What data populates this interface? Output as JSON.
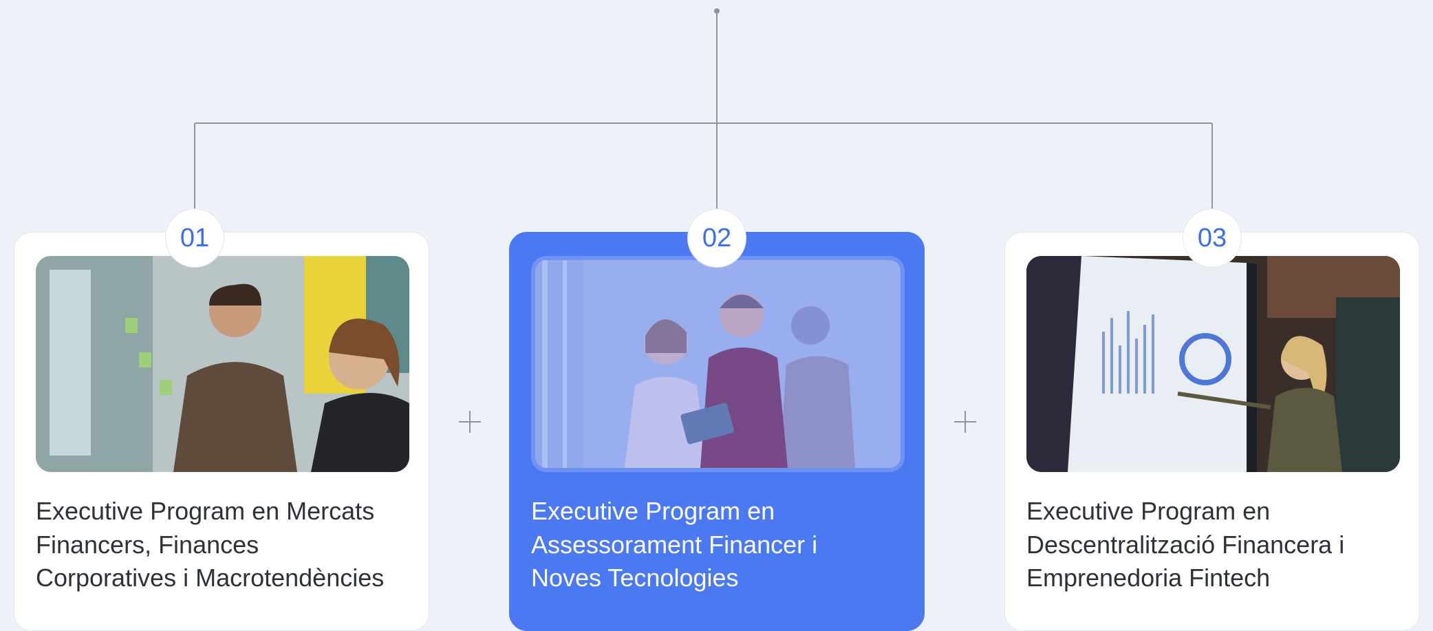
{
  "programs": [
    {
      "number": "01",
      "title": "Executive Program en Mercats Financers, Finances Corporatives i Macrotendències",
      "image": "team-meeting-photo",
      "active": false
    },
    {
      "number": "02",
      "title": "Executive Program  en Assessorament Financer i Noves Tecnologies",
      "image": "tablet-consultation-photo",
      "active": true
    },
    {
      "number": "03",
      "title": "Executive Program en Descentralització Financera i Emprenedoria Fintech",
      "image": "presentation-screen-photo",
      "active": false
    }
  ],
  "separators": [
    "plus-icon",
    "plus-icon"
  ],
  "colors": {
    "background": "#eef2f8",
    "accent": "#4a79f1",
    "number": "#3b6ee8",
    "connector": "#8c96a3"
  }
}
